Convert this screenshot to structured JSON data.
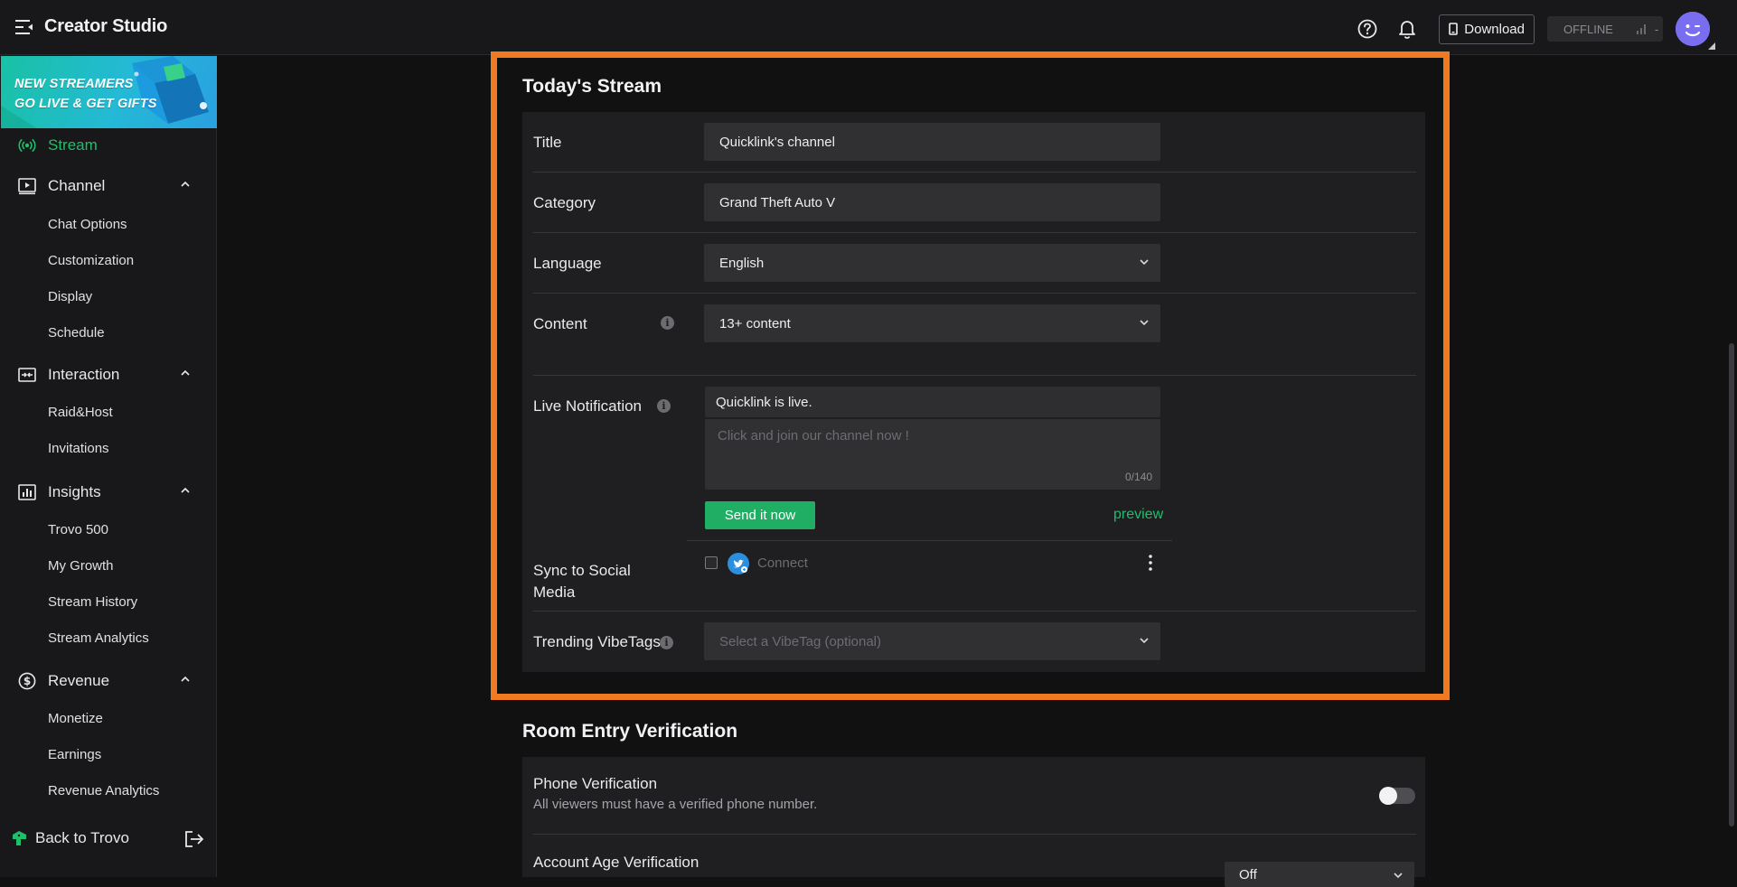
{
  "header": {
    "title": "Creator Studio",
    "download_label": "Download",
    "status_label": "OFFLINE",
    "status_value": "-"
  },
  "sidebar": {
    "banner": {
      "line1": "NEW STREAMERS",
      "line2": "GO LIVE & GET GIFTS"
    },
    "sections": [
      {
        "label": "Stream",
        "icon": "broadcast-icon",
        "active": true
      },
      {
        "label": "Channel",
        "icon": "play-square-icon",
        "expanded": true,
        "items": [
          "Chat Options",
          "Customization",
          "Display",
          "Schedule"
        ]
      },
      {
        "label": "Interaction",
        "icon": "interaction-icon",
        "expanded": true,
        "items": [
          "Raid&Host",
          "Invitations"
        ]
      },
      {
        "label": "Insights",
        "icon": "bar-chart-icon",
        "expanded": true,
        "items": [
          "Trovo 500",
          "My Growth",
          "Stream History",
          "Stream Analytics"
        ]
      },
      {
        "label": "Revenue",
        "icon": "dollar-circle-icon",
        "expanded": true,
        "items": [
          "Monetize",
          "Earnings",
          "Revenue Analytics"
        ]
      }
    ],
    "footer": {
      "label": "Back to Trovo"
    }
  },
  "todays_stream": {
    "title": "Today's Stream",
    "rows": {
      "title": {
        "label": "Title",
        "value": "Quicklink's channel"
      },
      "category": {
        "label": "Category",
        "value": "Grand Theft Auto V"
      },
      "language": {
        "label": "Language",
        "value": "English"
      },
      "content": {
        "label": "Content",
        "value": "13+ content"
      },
      "live_notification": {
        "label": "Live Notification",
        "headline": "Quicklink is live.",
        "message_placeholder": "Click and join our channel now !",
        "counter": "0/140",
        "send_label": "Send it now",
        "preview_label": "preview"
      },
      "sync_social": {
        "label_line1": "Sync to Social",
        "label_line2": "Media",
        "connect_label": "Connect"
      },
      "vibetags": {
        "label": "Trending VibeTags",
        "placeholder": "Select a VibeTag (optional)"
      }
    }
  },
  "room_entry": {
    "title": "Room Entry Verification",
    "phone": {
      "label": "Phone Verification",
      "description": "All viewers must have a verified phone number.",
      "enabled": false
    },
    "account_age": {
      "label": "Account Age Verification",
      "value": "Off"
    }
  },
  "colors": {
    "accent": "#1fbf6a",
    "highlight": "#f07a22",
    "avatar": "#7a6ef0"
  }
}
